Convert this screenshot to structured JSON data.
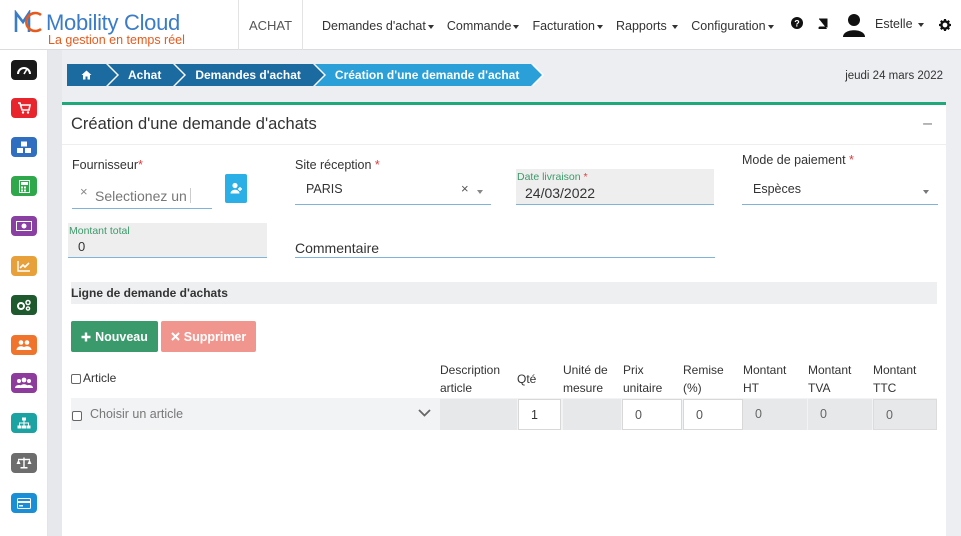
{
  "brand": {
    "name": "Mobility Cloud",
    "tagline": "La gestion en temps réel"
  },
  "header": {
    "app_tab": "ACHAT",
    "menu": [
      {
        "label": "Demandes d'achat"
      },
      {
        "label": "Commande"
      },
      {
        "label": "Facturation"
      },
      {
        "label": "Rapports"
      },
      {
        "label": "Configuration"
      }
    ],
    "icons": [
      "question-circle-icon",
      "book-icon",
      "user-avatar-icon",
      "gear-icon"
    ],
    "user": "Estelle"
  },
  "sidebar": {
    "items": [
      {
        "icon": "dashboard-icon",
        "color": "#1a1a1a"
      },
      {
        "icon": "cart-icon",
        "color": "#e8252c"
      },
      {
        "icon": "cubes-icon",
        "color": "#2f6ec0"
      },
      {
        "icon": "calculator-icon",
        "color": "#2ea84a"
      },
      {
        "icon": "money-icon",
        "color": "#8a3fa2"
      },
      {
        "icon": "chart-icon",
        "color": "#e8a13a"
      },
      {
        "icon": "cogs-icon",
        "color": "#1e5a2e"
      },
      {
        "icon": "users-icon",
        "color": "#f0742b"
      },
      {
        "icon": "group-icon",
        "color": "#8d3b9c"
      },
      {
        "icon": "sitemap-icon",
        "color": "#1ba3a3"
      },
      {
        "icon": "balance-icon",
        "color": "#6d6d6d"
      },
      {
        "icon": "credit-card-icon",
        "color": "#1a8fd6"
      }
    ]
  },
  "breadcrumb": [
    "Achat",
    "Demandes d'achat",
    "Création d'une demande d'achat"
  ],
  "date": "jeudi 24 mars 2022",
  "form": {
    "title": "Création d'une demande d'achats",
    "collapse": "–",
    "fournisseur": {
      "label": "Fournisseur",
      "placeholder": "Selectionez un",
      "clear": "×"
    },
    "site": {
      "label": "Site réception",
      "value": "PARIS",
      "clear": "×"
    },
    "date_livraison": {
      "label": "Date livraison",
      "value": "24/03/2022"
    },
    "mode_paiement": {
      "label": "Mode de paiement",
      "value": "Espèces"
    },
    "montant_total": {
      "label": "Montant total",
      "value": "0"
    },
    "commentaire": {
      "label": "Commentaire"
    },
    "required_mark": "*"
  },
  "lines": {
    "section_title": "Ligne de demande d'achats",
    "btn_new": "Nouveau",
    "btn_delete": "Supprimer",
    "columns": {
      "article": "Article",
      "description": [
        "Description",
        "article"
      ],
      "qte": "Qté",
      "unite": [
        "Unité de",
        "mesure"
      ],
      "prix": [
        "Prix",
        "unitaire"
      ],
      "remise": [
        "Remise",
        "(%)"
      ],
      "montant_ht": [
        "Montant",
        "HT"
      ],
      "montant_tva": [
        "Montant",
        "TVA"
      ],
      "montant_ttc": [
        "Montant",
        "TTC"
      ]
    },
    "row": {
      "article_placeholder": "Choisir un article",
      "qte": "1",
      "prix": "0",
      "remise": "0",
      "montant_ht": "0",
      "montant_tva": "0",
      "montant_ttc": "0"
    }
  }
}
